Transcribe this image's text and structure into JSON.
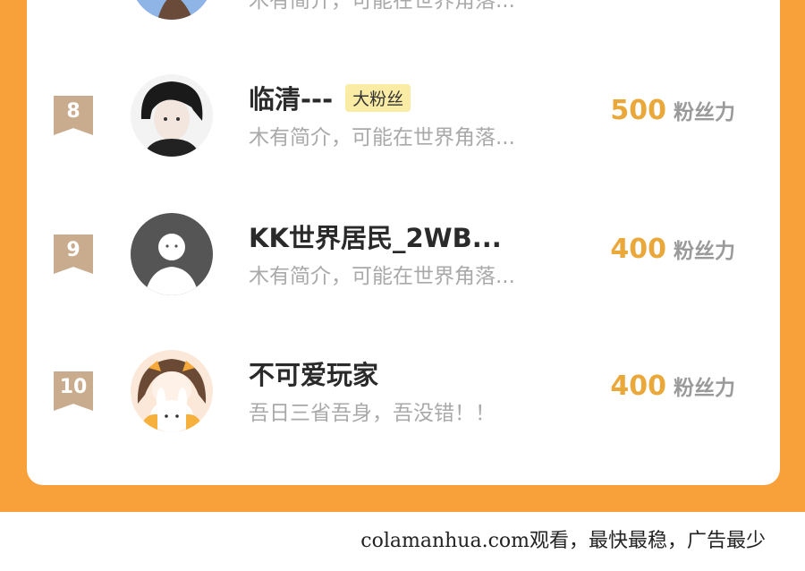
{
  "ranking": {
    "rows": [
      {
        "rank": "",
        "name": "",
        "badge": "",
        "bio": "木有简介，可能在世界角落...",
        "score": "",
        "unit": ""
      },
      {
        "rank": "8",
        "name": "临清---",
        "badge": "大粉丝",
        "bio": "木有简介，可能在世界角落...",
        "score": "500",
        "unit": "粉丝力"
      },
      {
        "rank": "9",
        "name": "KK世界居民_2WB...",
        "badge": "",
        "bio": "木有简介，可能在世界角落...",
        "score": "400",
        "unit": "粉丝力"
      },
      {
        "rank": "10",
        "name": "不可爱玩家",
        "badge": "",
        "bio": "吾日三省吾身，吾没错！！",
        "score": "400",
        "unit": "粉丝力"
      }
    ]
  },
  "footer": {
    "text": "colamanhua.com观看，最快最稳，广告最少"
  },
  "colors": {
    "frame": "#f8a03a",
    "score": "#eba83a",
    "rank_badge": "#c9ab8e",
    "fan_badge": "#fbeca5"
  }
}
